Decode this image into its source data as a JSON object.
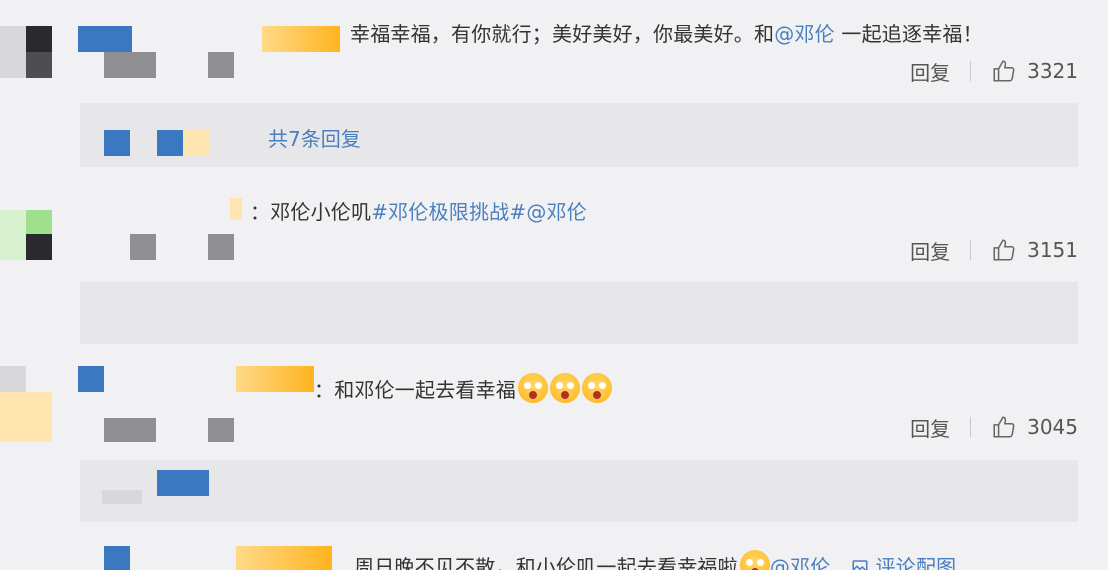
{
  "comments": [
    {
      "text_before": "幸福幸福，有你就行；美好美好，你最美好。和",
      "mention": "@邓伦",
      "text_after": " 一起追逐幸福！",
      "reply_label": "回复",
      "like_count": "3321",
      "replies_link": "共7条回复"
    },
    {
      "text_before": "：邓伦小伦叽",
      "topic": "#邓伦极限挑战#",
      "mention": "@邓伦",
      "reply_label": "回复",
      "like_count": "3151"
    },
    {
      "text_before": "：和邓伦一起去看幸福",
      "reply_label": "回复",
      "like_count": "3045"
    },
    {
      "text_before": "周日晚不见不散，和小伦叽一起去看幸福啦",
      "mention": "@邓伦",
      "view_pic": "评论配图"
    }
  ],
  "icons": {
    "like": "thumbs-up-icon",
    "emoji": "scared-face-emoji",
    "picture": "picture-icon"
  },
  "colors": {
    "link": "#4a7fbe",
    "text": "#333333",
    "background": "#f1f1f3",
    "reply_box": "#e7e7ea"
  }
}
